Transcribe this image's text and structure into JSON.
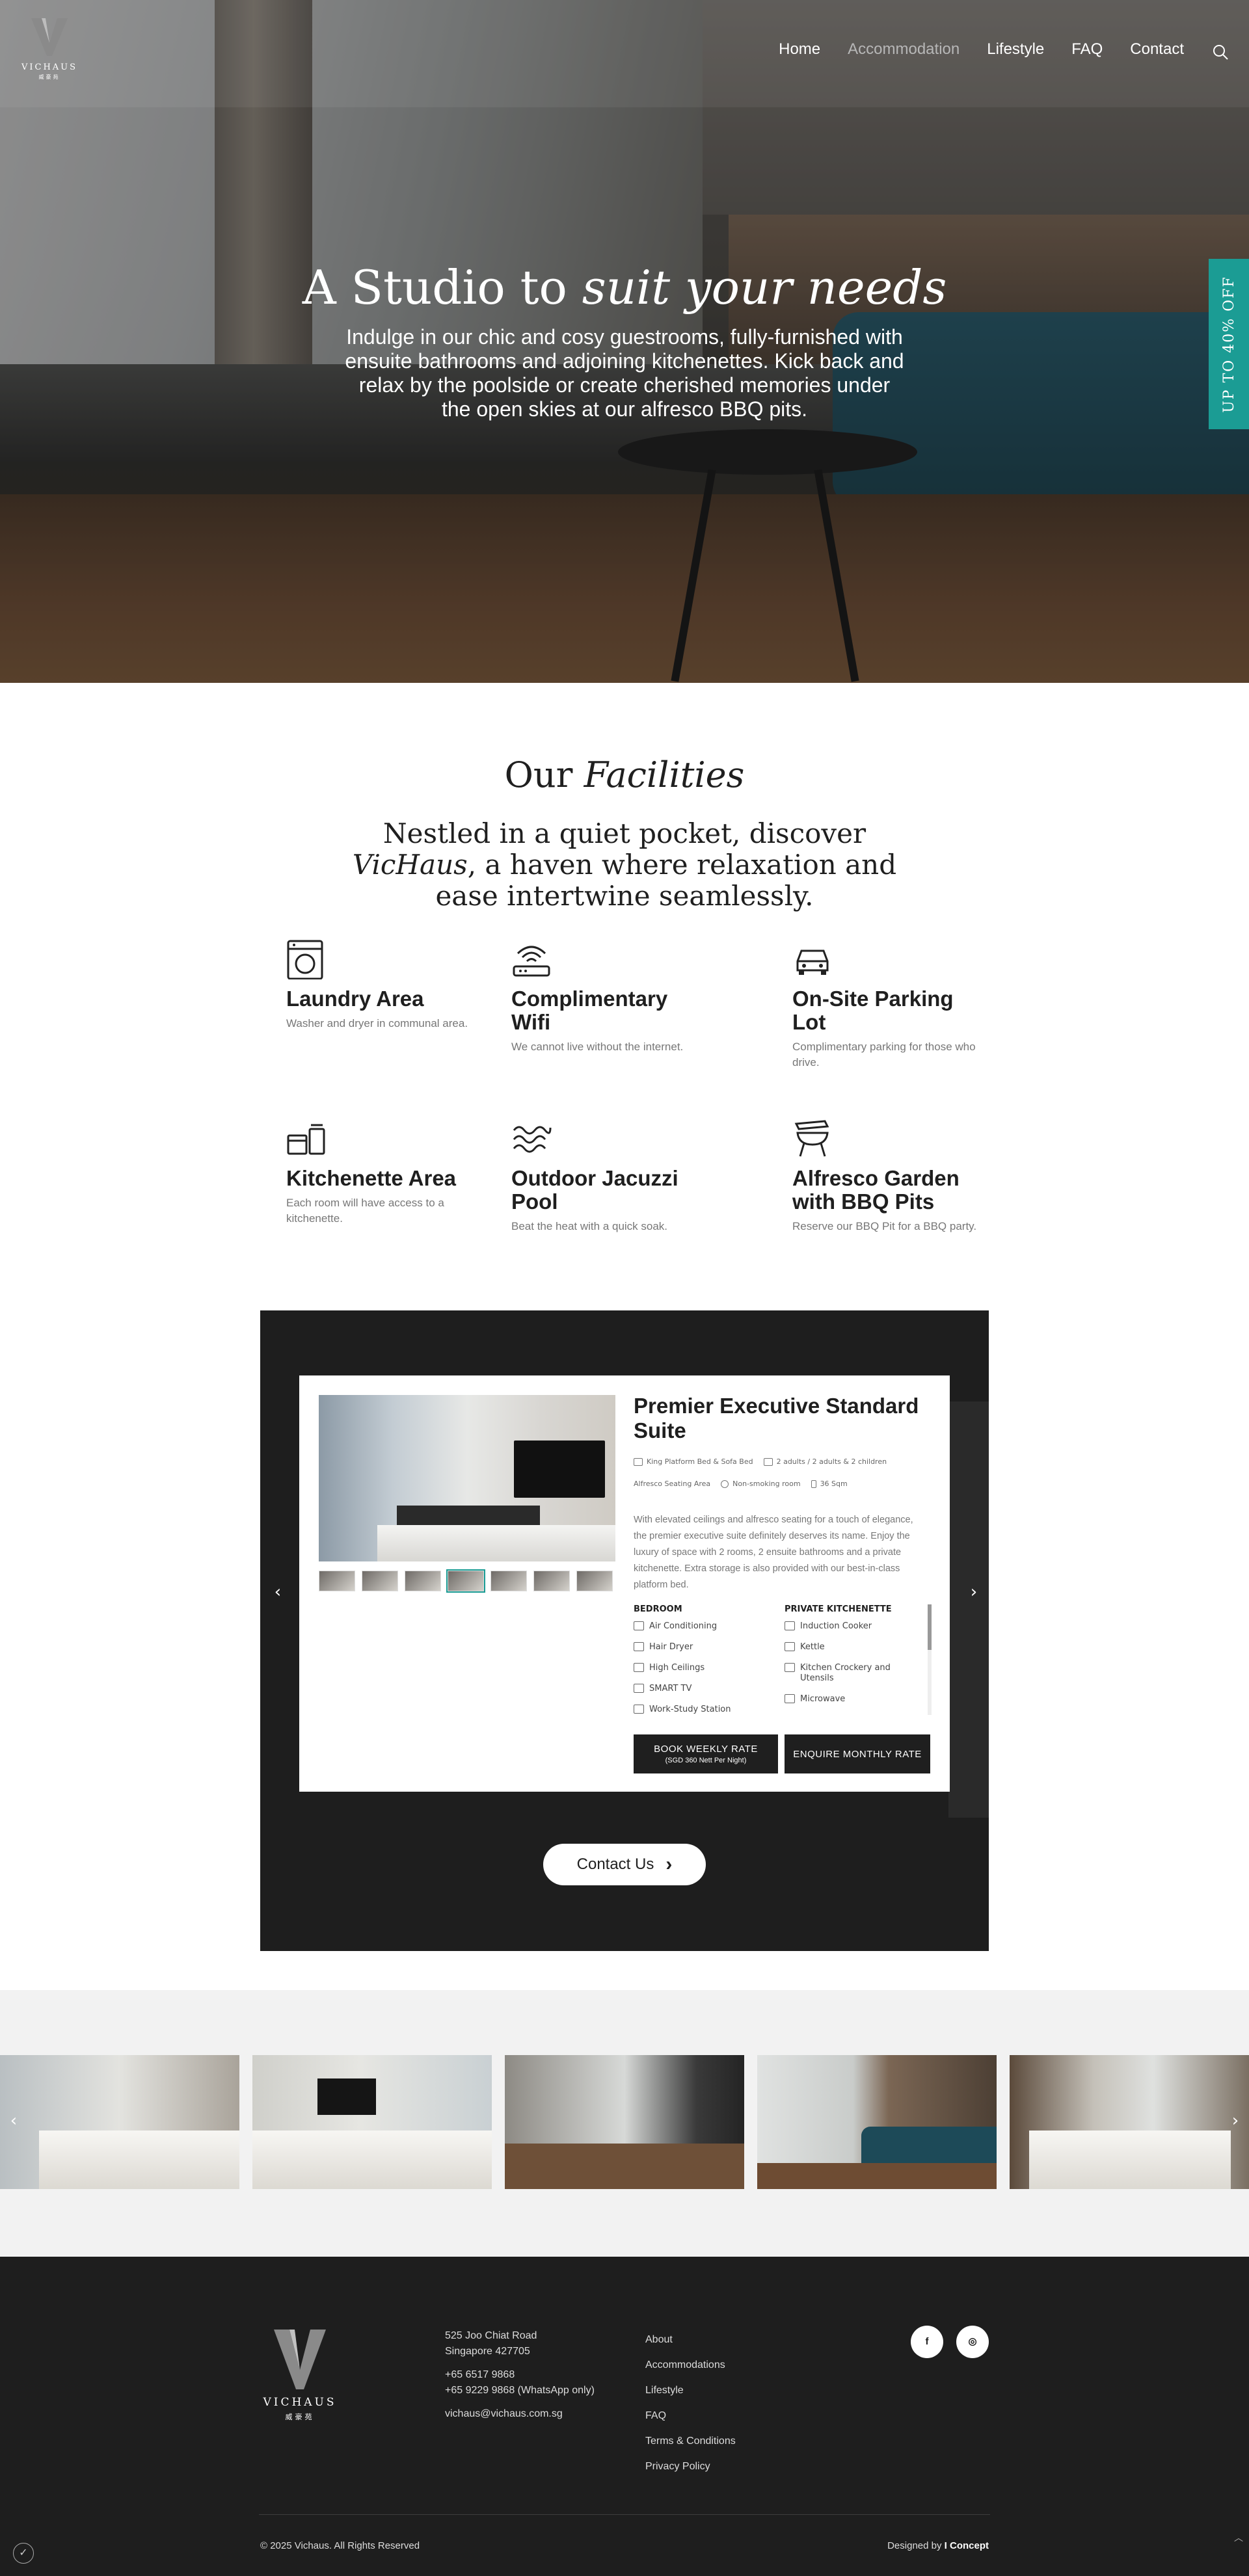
{
  "brand": {
    "name": "VICHAUS",
    "name_cn": "威豪苑"
  },
  "nav": {
    "items": [
      "Home",
      "Accommodation",
      "Lifestyle",
      "FAQ",
      "Contact"
    ],
    "active": "Accommodation",
    "search_icon": "search-icon"
  },
  "hero": {
    "title_plain": "A Studio to ",
    "title_italic": "suit your needs",
    "text": "Indulge in our chic and cosy guestrooms, fully-furnished with ensuite bathrooms and adjoining kitchenettes. Kick back and relax by the poolside or create cherished memories under the open skies at our alfresco BBQ pits."
  },
  "promo_tab": {
    "label": "UP TO 40% OFF",
    "color": "#1b9c94"
  },
  "facilities": {
    "title_plain": "Our ",
    "title_italic": "Facilities",
    "intro_before": "Nestled in a quiet pocket, discover ",
    "intro_italic": "VicHaus",
    "intro_after": ", a haven where relaxation and ease intertwine seamlessly.",
    "items": [
      {
        "icon": "washing-machine-icon",
        "title": "Laundry Area",
        "desc": "Washer and dryer in communal area."
      },
      {
        "icon": "wifi-router-icon",
        "title": "Complimentary Wifi",
        "desc": "We cannot live without the internet."
      },
      {
        "icon": "car-icon",
        "title": "On-Site Parking Lot",
        "desc": "Complimentary parking for those who drive."
      },
      {
        "icon": "kitchen-appliances-icon",
        "title": "Kitchenette Area",
        "desc": "Each room will have access to a kitchenette."
      },
      {
        "icon": "water-waves-icon",
        "title": "Outdoor Jacuzzi Pool",
        "desc": "Beat the heat with a quick soak."
      },
      {
        "icon": "bbq-grill-icon",
        "title": "Alfresco Garden with BBQ Pits",
        "desc": "Reserve our BBQ Pit for a BBQ party."
      }
    ]
  },
  "room": {
    "name": "Premier Executive Standard Suite",
    "specs": [
      {
        "icon": "bed-icon",
        "label": "King Platform Bed & Sofa Bed"
      },
      {
        "icon": "guests-icon",
        "label": "2 adults / 2 adults & 2 children"
      },
      {
        "icon": "seating-icon",
        "label": "Alfresco Seating Area"
      },
      {
        "icon": "no-smoking-icon",
        "label": "Non-smoking room"
      },
      {
        "icon": "area-icon",
        "label": "36 Sqm"
      }
    ],
    "description": "With elevated ceilings and alfresco seating for a touch of elegance, the premier executive suite definitely deserves its name. Enjoy the luxury of space with 2 rooms, 2 ensuite bathrooms and a private kitchenette. Extra storage is also provided with our best-in-class platform bed.",
    "bedroom_heading": "BEDROOM",
    "bedroom_items": [
      "Air Conditioning",
      "Hair Dryer",
      "High Ceilings",
      "SMART TV",
      "Work-Study Station"
    ],
    "kitchen_heading": "PRIVATE KITCHENETTE",
    "kitchen_items": [
      "Induction Cooker",
      "Kettle",
      "Kitchen Crockery and Utensils",
      "Microwave"
    ],
    "book_weekly": "BOOK WEEKLY RATE",
    "book_weekly_sub": "(SGD 360 Nett Per Night)",
    "enquire_monthly": "ENQUIRE MONTHLY RATE",
    "thumb_count": 7,
    "active_thumb": 4
  },
  "contact_button": "Contact Us",
  "gallery": {
    "image_count": 5
  },
  "footer": {
    "address_line1": "525 Joo Chiat Road",
    "address_line2": "Singapore 427705",
    "phone1": "+65 6517 9868",
    "phone2": "+65 9229 9868 (WhatsApp only)",
    "email": "vichaus@vichaus.com.sg",
    "links": [
      "About",
      "Accommodations",
      "Lifestyle",
      "FAQ",
      "Terms & Conditions",
      "Privacy Policy"
    ],
    "social": [
      {
        "icon": "facebook-icon",
        "glyph": "f"
      },
      {
        "icon": "instagram-icon",
        "glyph": "◎"
      }
    ],
    "copyright": "© 2025 Vichaus. All Rights Reserved",
    "designed_by_label": "Designed by ",
    "designed_by_name": "I Concept"
  }
}
